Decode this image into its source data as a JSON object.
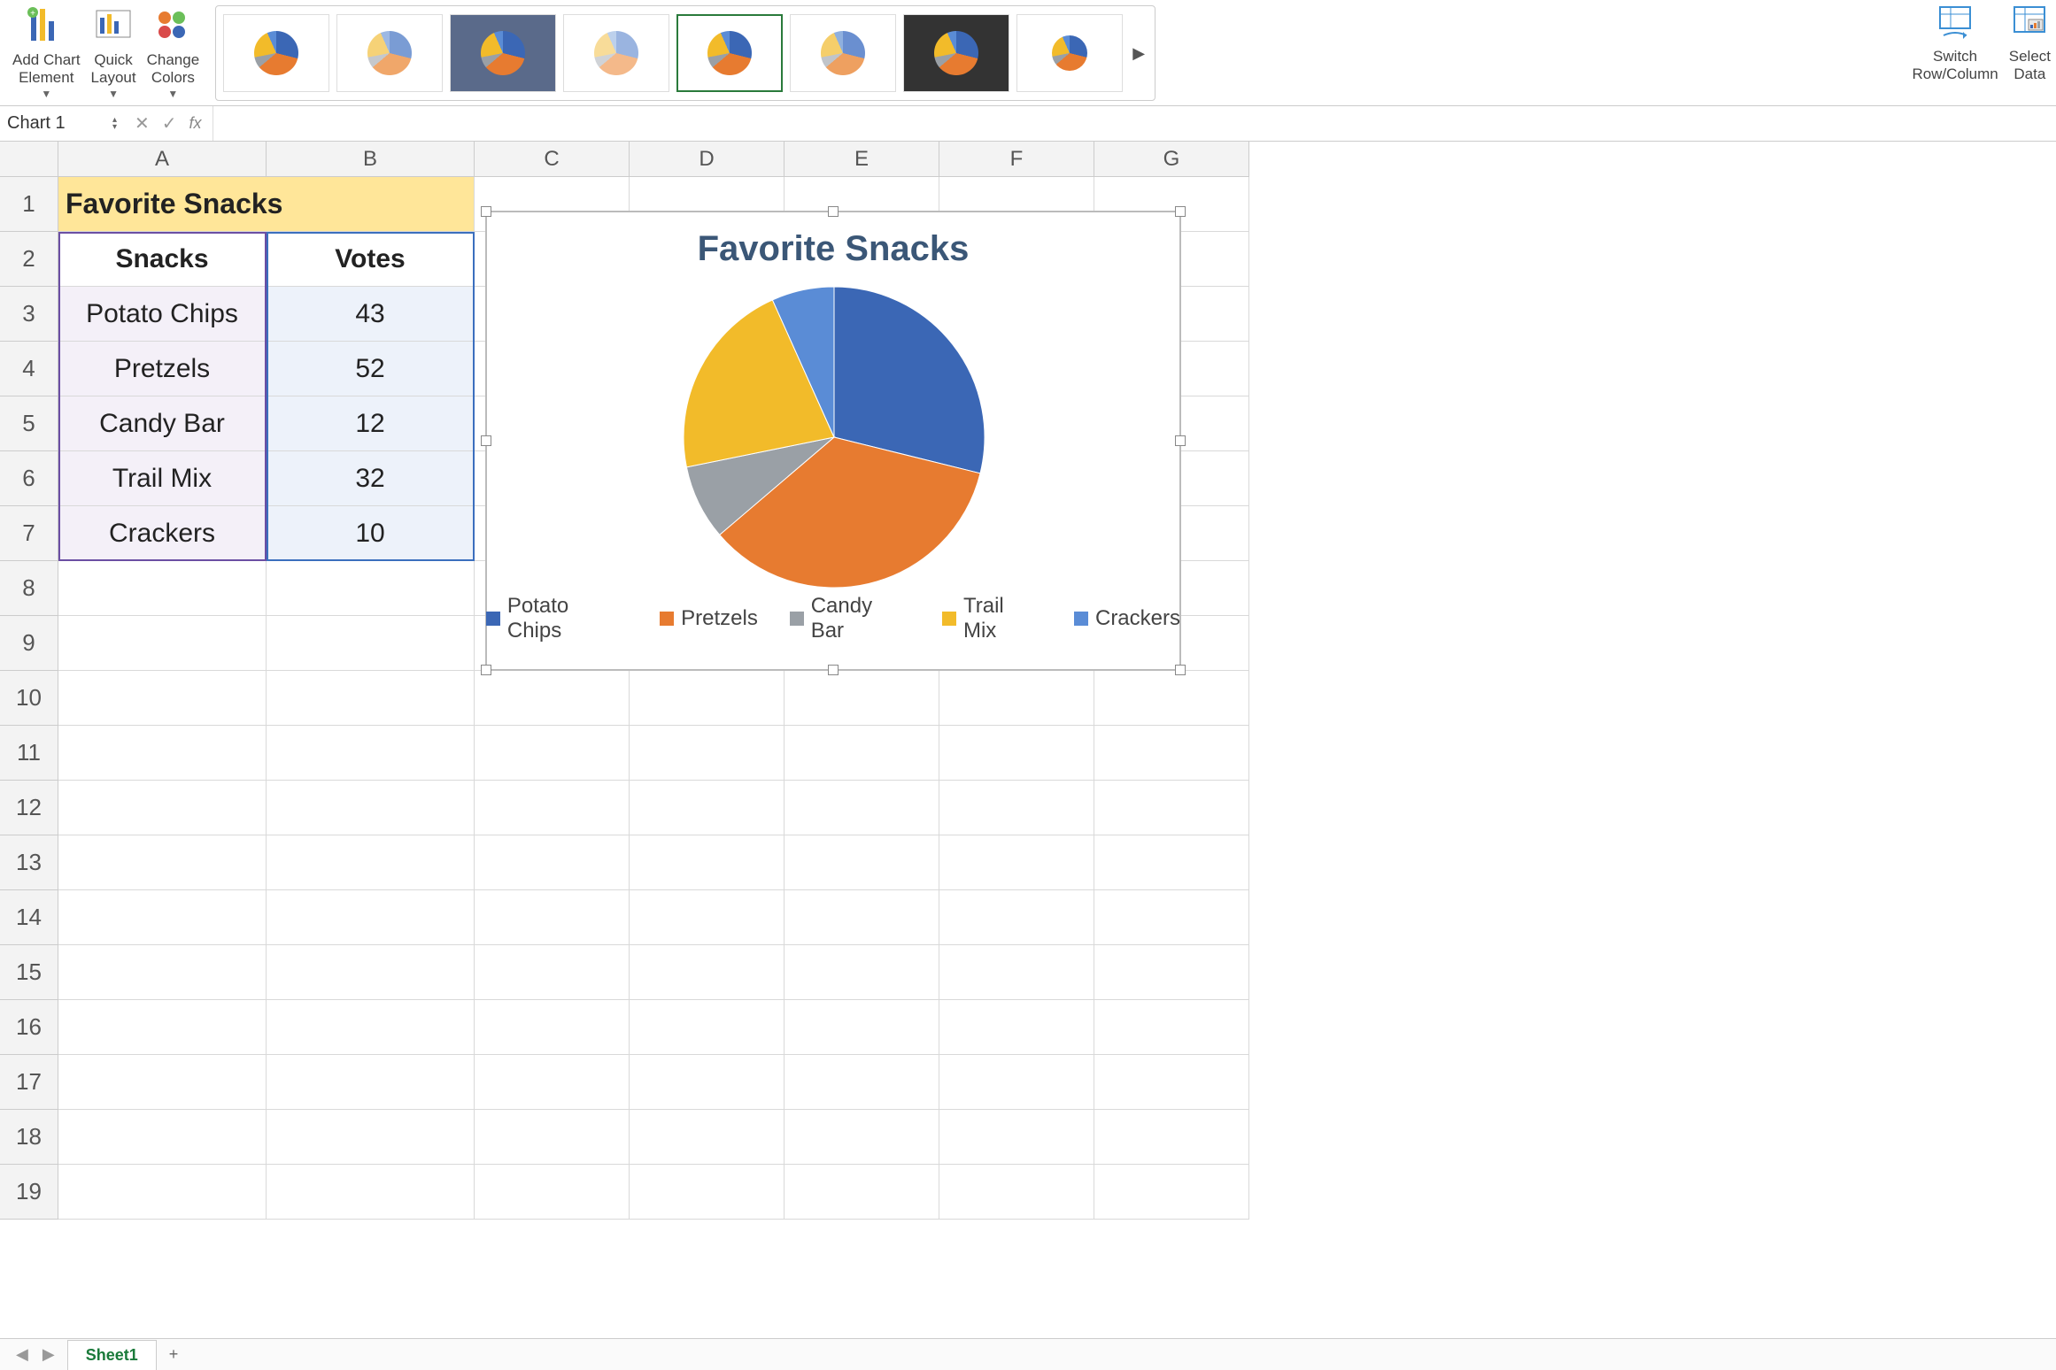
{
  "ribbon": {
    "add_chart_element": "Add Chart\nElement",
    "quick_layout": "Quick\nLayout",
    "change_colors": "Change\nColors",
    "switch_row_col": "Switch\nRow/Column",
    "select_data": "Select\nData"
  },
  "formula_bar": {
    "name_box": "Chart 1",
    "fx": "fx"
  },
  "columns": [
    "A",
    "B",
    "C",
    "D",
    "E",
    "F",
    "G"
  ],
  "rows": [
    "1",
    "2",
    "3",
    "4",
    "5",
    "6",
    "7",
    "8",
    "9",
    "10",
    "11",
    "12",
    "13",
    "14",
    "15",
    "16",
    "17",
    "18",
    "19"
  ],
  "cells": {
    "title": "Favorite Snacks",
    "headers": {
      "A": "Snacks",
      "B": "Votes"
    },
    "data": [
      {
        "snack": "Potato Chips",
        "votes": "43"
      },
      {
        "snack": "Pretzels",
        "votes": "52"
      },
      {
        "snack": "Candy Bar",
        "votes": "12"
      },
      {
        "snack": "Trail Mix",
        "votes": "32"
      },
      {
        "snack": "Crackers",
        "votes": "10"
      }
    ]
  },
  "chart": {
    "title": "Favorite Snacks",
    "legend": [
      "Potato Chips",
      "Pretzels",
      "Candy Bar",
      "Trail Mix",
      "Crackers"
    ],
    "colors": [
      "#3b67b5",
      "#e77b30",
      "#9aa0a6",
      "#f2bb2a",
      "#5a8cd6"
    ]
  },
  "chart_data": {
    "type": "pie",
    "title": "Favorite Snacks",
    "categories": [
      "Potato Chips",
      "Pretzels",
      "Candy Bar",
      "Trail Mix",
      "Crackers"
    ],
    "values": [
      43,
      52,
      12,
      32,
      10
    ],
    "colors": [
      "#3b67b5",
      "#e77b30",
      "#9aa0a6",
      "#f2bb2a",
      "#5a8cd6"
    ]
  },
  "sheet_tabs": {
    "active": "Sheet1",
    "add": "+"
  }
}
